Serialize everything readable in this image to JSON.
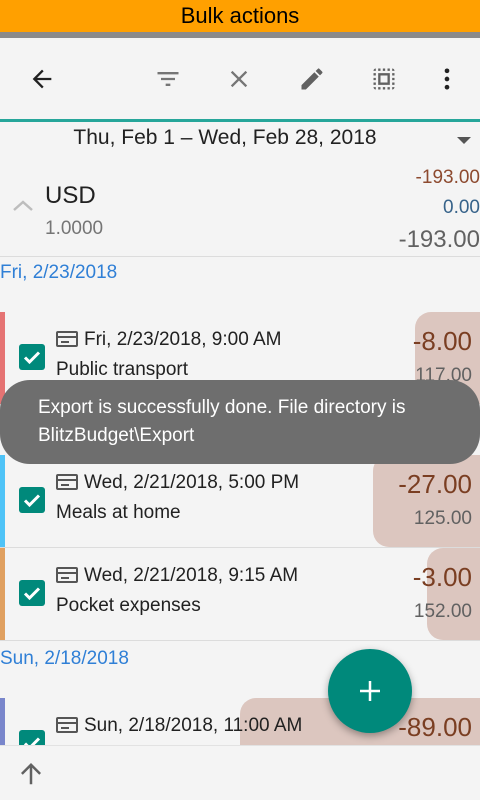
{
  "banner": {
    "title": "Bulk actions"
  },
  "toolbar": {
    "back_icon": "arrow-left-icon",
    "filter_icon": "filter-icon",
    "close_icon": "close-icon",
    "edit_icon": "pencil-icon",
    "select_all_icon": "select-all-icon",
    "more_icon": "more-vert-icon"
  },
  "date_range": {
    "label": "Thu, Feb 1 – Wed, Feb 28, 2018"
  },
  "currency": {
    "code": "USD",
    "rate": "1.0000",
    "expenses": "-193.00",
    "income": "0.00",
    "total": "-193.00"
  },
  "groups": [
    {
      "header": "Fri, 2/23/2018"
    },
    {
      "header": "Sun, 2/18/2018"
    }
  ],
  "transactions": [
    {
      "datetime": "Fri, 2/23/2018, 9:00 AM",
      "description": "Public transport",
      "amount": "-8.00",
      "balance": "117.00",
      "category_color": "#e57373"
    },
    {
      "datetime": "Wed, 2/21/2018, 5:00 PM",
      "description": "Meals at home",
      "amount": "-27.00",
      "balance": "125.00",
      "category_color": "#4fc3f7"
    },
    {
      "datetime": "Wed, 2/21/2018, 9:15 AM",
      "description": "Pocket expenses",
      "amount": "-3.00",
      "balance": "152.00",
      "category_color": "#e0a060"
    },
    {
      "datetime": "Sun, 2/18/2018, 11:00 AM",
      "description": "",
      "amount": "-89.00",
      "balance": "",
      "category_color": "#7986cb"
    }
  ],
  "toast": {
    "message": "Export is successfully done. File directory is BlitzBudget\\Export"
  },
  "fab": {
    "icon": "plus-icon"
  },
  "bottom": {
    "icon": "arrow-up-icon"
  },
  "colors": {
    "accent": "#00897b",
    "banner": "#ffa000",
    "amount_bg": "#dcc6bf"
  }
}
